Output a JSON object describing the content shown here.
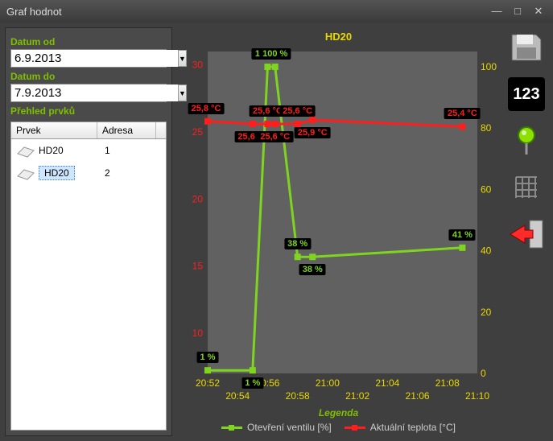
{
  "window": {
    "title": "Graf hodnot"
  },
  "sidebar": {
    "date_from_label": "Datum od",
    "date_from": "6.9.2013",
    "date_to_label": "Datum do",
    "date_to": "7.9.2013",
    "list_label": "Přehled prvků",
    "cols": [
      "Prvek",
      "Adresa"
    ],
    "rows": [
      {
        "name": "HD20",
        "addr": "1",
        "selected": false
      },
      {
        "name": "HD20",
        "addr": "2",
        "selected": true
      }
    ]
  },
  "toolbar": {
    "save_icon": "floppy-icon",
    "values_icon": "123-icon",
    "values_text": "123",
    "pin_icon": "pin-icon",
    "grid_icon": "grid-icon",
    "exit_icon": "exit-arrow-icon"
  },
  "legend": {
    "title": "Legenda",
    "series": [
      {
        "name": "Otevření ventilu [%]",
        "color": "#7fd420"
      },
      {
        "name": "Aktuální teplota [°C]",
        "color": "#ff1e1e"
      }
    ]
  },
  "chart_data": {
    "type": "line",
    "title": "HD20",
    "x_ticks": [
      "20:52",
      "20:54",
      "20:56",
      "20:58",
      "21:00",
      "21:02",
      "21:04",
      "21:06",
      "21:08",
      "21:10"
    ],
    "y_left": {
      "label": "",
      "ticks": [
        10,
        15,
        20,
        25,
        30
      ],
      "range": [
        7,
        31
      ],
      "color": "#ff1e1e"
    },
    "y_right": {
      "label": "",
      "ticks": [
        0,
        20,
        40,
        60,
        80,
        100
      ],
      "range": [
        0,
        105
      ],
      "color": "#e8d800"
    },
    "series": [
      {
        "name": "Otevření ventilu [%]",
        "axis": "right",
        "color": "#7fd420",
        "points": [
          {
            "x": "20:52",
            "y": 1,
            "label": "1 %"
          },
          {
            "x": "20:55",
            "y": 1,
            "label": "1 %"
          },
          {
            "x": "20:56",
            "y": 100,
            "label": "100 %"
          },
          {
            "x": "20:56:30",
            "y": 100,
            "label": "100 %"
          },
          {
            "x": "20:58",
            "y": 38,
            "label": "38 %"
          },
          {
            "x": "20:59",
            "y": 38,
            "label": "38 %"
          },
          {
            "x": "21:09",
            "y": 41,
            "label": "41 %"
          }
        ]
      },
      {
        "name": "Aktuální teplota [°C]",
        "axis": "left",
        "color": "#ff1e1e",
        "points": [
          {
            "x": "20:52",
            "y": 25.8,
            "label": "25,8 °C"
          },
          {
            "x": "20:55",
            "y": 25.6,
            "label": "25,6 °C"
          },
          {
            "x": "20:56",
            "y": 25.6,
            "label": "25,6 °C"
          },
          {
            "x": "20:56:30",
            "y": 25.6,
            "label": "25,6 °C"
          },
          {
            "x": "20:58",
            "y": 25.6,
            "label": "25,6 °C"
          },
          {
            "x": "20:59",
            "y": 25.9,
            "label": "25,9 °C"
          },
          {
            "x": "21:09",
            "y": 25.4,
            "label": "25,4 °C"
          }
        ]
      }
    ]
  }
}
